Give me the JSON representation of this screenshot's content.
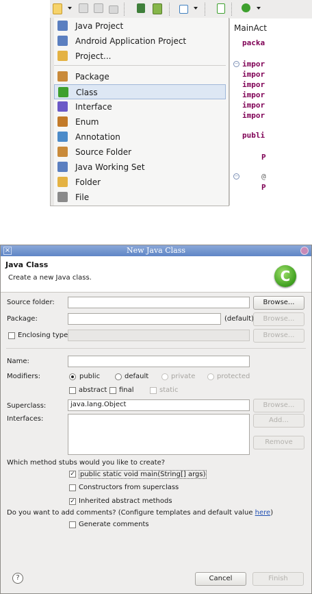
{
  "menu": {
    "items": [
      {
        "label": "Java Project",
        "icon": "java-project-icon",
        "color": "#5b7fc0"
      },
      {
        "label": "Android Application Project",
        "icon": "android-project-icon",
        "color": "#5b7fc0"
      },
      {
        "label": "Project...",
        "icon": "project-icon",
        "color": "#e4b243"
      },
      {
        "label": "Package",
        "icon": "package-icon",
        "color": "#c98a3a"
      },
      {
        "label": "Class",
        "icon": "class-icon",
        "color": "#3ea02e"
      },
      {
        "label": "Interface",
        "icon": "interface-icon",
        "color": "#6b59c7"
      },
      {
        "label": "Enum",
        "icon": "enum-icon",
        "color": "#c27a29"
      },
      {
        "label": "Annotation",
        "icon": "annotation-icon",
        "color": "#4c8bc9"
      },
      {
        "label": "Source Folder",
        "icon": "source-folder-icon",
        "color": "#c98a3a"
      },
      {
        "label": "Java Working Set",
        "icon": "working-set-icon",
        "color": "#5b7fc0"
      },
      {
        "label": "Folder",
        "icon": "folder-icon",
        "color": "#e4b243"
      },
      {
        "label": "File",
        "icon": "file-icon",
        "color": "#8a8a8a"
      }
    ],
    "selected": "Class"
  },
  "editor": {
    "tab": "MainAct",
    "lines": [
      "packa",
      "impor",
      "impor",
      "impor",
      "impor",
      "impor",
      "impor",
      "publi",
      "P",
      "@",
      "P"
    ]
  },
  "dialog": {
    "title": "New Java Class",
    "heading": "Java Class",
    "description": "Create a new Java class.",
    "logo_letter": "C",
    "source_folder_label": "Source folder:",
    "source_folder_value": "",
    "package_label": "Package:",
    "package_value": "",
    "package_default": "(default)",
    "enclosing_type_label": "Enclosing type:",
    "enclosing_type_checked": false,
    "name_label": "Name:",
    "name_value": "",
    "modifiers_label": "Modifiers:",
    "modifiers": {
      "public": "public",
      "default": "default",
      "private": "private",
      "protected": "protected",
      "abstract": "abstract",
      "final": "final",
      "static": "static",
      "selected": "public"
    },
    "superclass_label": "Superclass:",
    "superclass_value": "java.lang.Object",
    "interfaces_label": "Interfaces:",
    "stubs_question": "Which method stubs would you like to create?",
    "stubs": [
      {
        "label": "public static void main(String[] args)",
        "checked": true
      },
      {
        "label": "Constructors from superclass",
        "checked": false
      },
      {
        "label": "Inherited abstract methods",
        "checked": true
      }
    ],
    "comments_question": "Do you want to add comments? (Configure templates and default value ",
    "comments_link": "here",
    "comments_suffix": ")",
    "generate_comments_label": "Generate comments",
    "generate_comments_checked": false,
    "buttons": {
      "browse": "Browse...",
      "add": "Add...",
      "remove": "Remove",
      "cancel": "Cancel",
      "finish": "Finish",
      "help": "?"
    }
  }
}
